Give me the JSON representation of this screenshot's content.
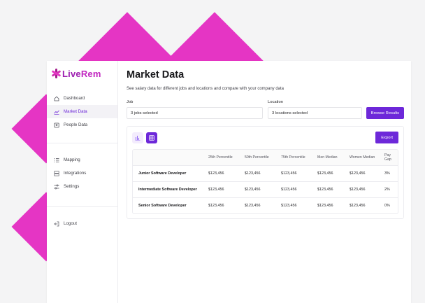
{
  "brand": {
    "name_part1": "Live",
    "name_part2": "Rem"
  },
  "sidebar": {
    "items": [
      {
        "label": "Dashboard",
        "icon": "home-icon"
      },
      {
        "label": "Market Data",
        "icon": "chart-line-icon",
        "active": true
      },
      {
        "label": "People Data",
        "icon": "people-data-icon"
      },
      {
        "label": "Mapping",
        "icon": "list-icon"
      },
      {
        "label": "Integrations",
        "icon": "integrations-icon"
      },
      {
        "label": "Settings",
        "icon": "sliders-icon"
      },
      {
        "label": "Logout",
        "icon": "logout-icon"
      }
    ]
  },
  "page": {
    "title": "Market Data",
    "subtitle": "See salary data for different jobs and locations and compare with your company data"
  },
  "filters": {
    "job_label": "Job",
    "job_value": "3 jobs selected",
    "location_label": "Location",
    "location_value": "3 locations selected",
    "browse_label": "Browse Results"
  },
  "toolbar": {
    "export_label": "Export"
  },
  "table": {
    "headers": [
      "",
      "25th Percentile",
      "50th Percentile",
      "75th Percentile",
      "Men Median",
      "Women Median",
      "Pay Gap"
    ],
    "rows": [
      [
        "Junior Software Developer",
        "$123,456",
        "$123,456",
        "$123,456",
        "$123,456",
        "$123,456",
        "3%"
      ],
      [
        "Intermediate Software Developer",
        "$123,456",
        "$123,456",
        "$123,456",
        "$123,456",
        "$123,456",
        "2%"
      ],
      [
        "Senior Software Developer",
        "$123,456",
        "$123,456",
        "$123,456",
        "$123,456",
        "$123,456",
        "0%"
      ]
    ]
  },
  "colors": {
    "accent": "#6d28d9",
    "decoration": "#e535c4",
    "brand": "#9d1fb0"
  }
}
